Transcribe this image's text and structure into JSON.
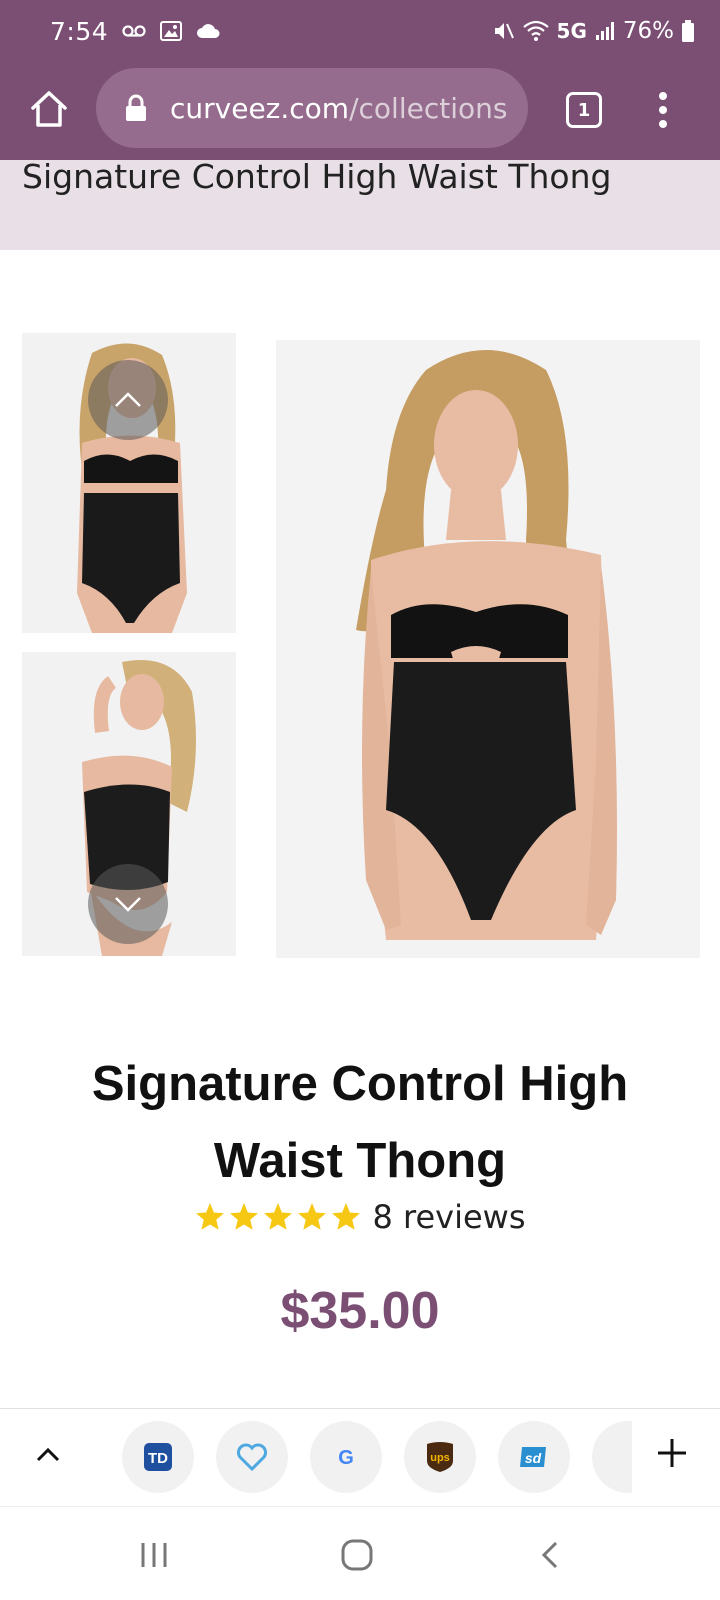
{
  "status_bar": {
    "time": "7:54",
    "network": "5G",
    "battery": "76%"
  },
  "browser": {
    "url_domain": "curveez.com",
    "url_path": "/collections",
    "tab_count": "1"
  },
  "page": {
    "header_title": "Signature Control High Waist Thong",
    "product_title": "Signature Control High Waist Thong",
    "rating": 5,
    "reviews": "8 reviews",
    "price": "$35.00"
  },
  "shortcuts": [
    {
      "name": "td-shortcut",
      "label": "TD"
    },
    {
      "name": "heart-shortcut",
      "label": ""
    },
    {
      "name": "google-shortcut",
      "label": "G"
    },
    {
      "name": "ups-shortcut",
      "label": "ups"
    },
    {
      "name": "sd-shortcut",
      "label": "sd"
    }
  ],
  "colors": {
    "brand": "#7b4e73",
    "star": "#f6c813",
    "title_strip": "#e8dfe7"
  }
}
